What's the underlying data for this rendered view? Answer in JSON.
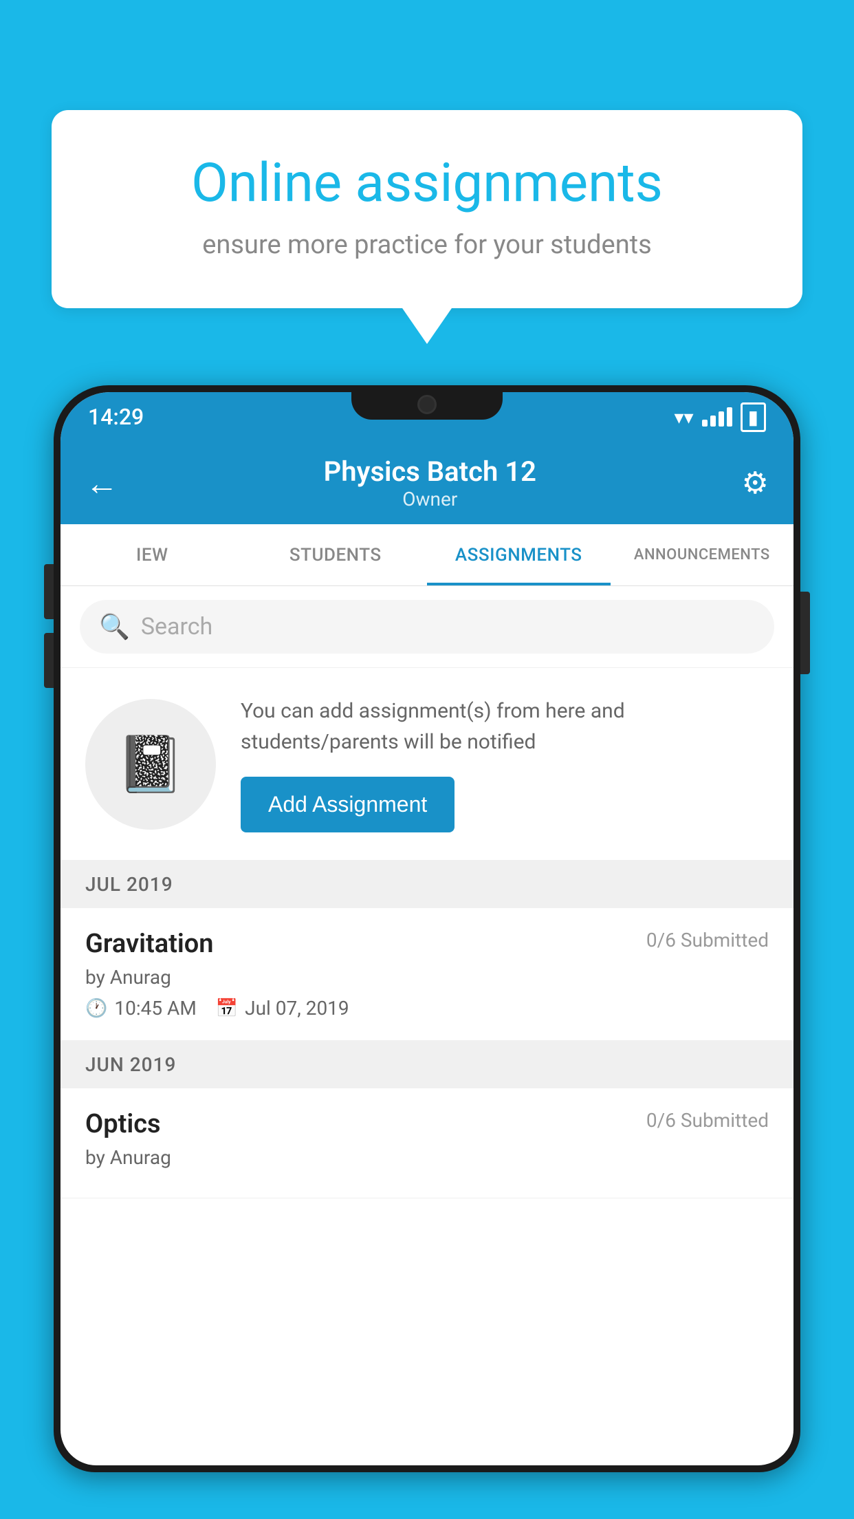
{
  "background_color": "#1ab8e8",
  "speech_bubble": {
    "title": "Online assignments",
    "subtitle": "ensure more practice for your students"
  },
  "status_bar": {
    "time": "14:29"
  },
  "app_bar": {
    "title": "Physics Batch 12",
    "subtitle": "Owner",
    "back_label": "←",
    "settings_label": "⚙"
  },
  "tabs": [
    {
      "label": "IEW",
      "active": false
    },
    {
      "label": "STUDENTS",
      "active": false
    },
    {
      "label": "ASSIGNMENTS",
      "active": true
    },
    {
      "label": "ANNOUNCEMENTS",
      "active": false
    }
  ],
  "search": {
    "placeholder": "Search"
  },
  "add_assignment": {
    "description": "You can add assignment(s) from here and students/parents will be notified",
    "button_label": "Add Assignment"
  },
  "sections": [
    {
      "header": "JUL 2019",
      "assignments": [
        {
          "name": "Gravitation",
          "submitted": "0/6 Submitted",
          "by": "by Anurag",
          "time": "10:45 AM",
          "date": "Jul 07, 2019"
        }
      ]
    },
    {
      "header": "JUN 2019",
      "assignments": [
        {
          "name": "Optics",
          "submitted": "0/6 Submitted",
          "by": "by Anurag",
          "time": "",
          "date": ""
        }
      ]
    }
  ]
}
